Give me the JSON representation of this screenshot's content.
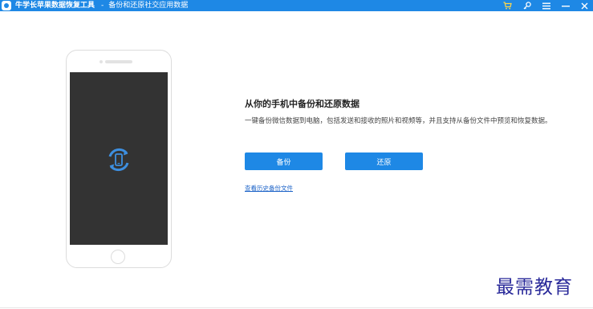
{
  "titlebar": {
    "app_name": "牛学长苹果数据恢复工具",
    "separator": "-",
    "subtitle": "备份和还原社交应用数据",
    "icons": [
      "cart-icon",
      "key-icon",
      "menu-icon",
      "minimize-icon",
      "close-icon"
    ],
    "bg_color": "#1e88e5"
  },
  "main": {
    "heading": "从你的手机中备份和还原数据",
    "description": "一键备份微信数据到电脑，包括发送和接收的照片和视频等，并且支持从备份文件中预览和恢复数据。",
    "backup_label": "备份",
    "restore_label": "还原",
    "history_link": "查看历史备份文件",
    "accent_color": "#1e88e5"
  },
  "phone": {
    "screen_icon": "sync-phone-icon"
  },
  "watermark": "最需教育"
}
